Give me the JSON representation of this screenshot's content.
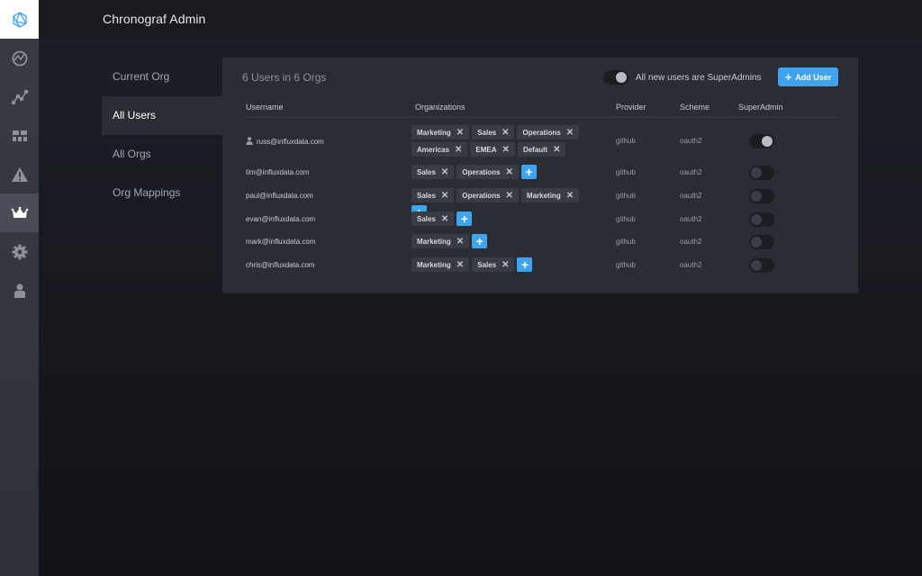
{
  "header": {
    "title": "Chronograf Admin"
  },
  "sidebar": {
    "icons": [
      "logo-icon",
      "status-icon",
      "data-explorer-icon",
      "dashboards-icon",
      "alerts-icon",
      "admin-crown-icon",
      "config-gear-icon",
      "user-icon"
    ]
  },
  "subnav": {
    "items": [
      {
        "label": "Current Org"
      },
      {
        "label": "All Users"
      },
      {
        "label": "All Orgs"
      },
      {
        "label": "Org Mappings"
      }
    ]
  },
  "panel": {
    "title": "6 Users in 6 Orgs",
    "superadmin_toggle_label": "All new users are SuperAdmins",
    "superadmin_toggle_on": true,
    "add_user_label": "Add User"
  },
  "table": {
    "headers": {
      "username": "Username",
      "organizations": "Organizations",
      "provider": "Provider",
      "scheme": "Scheme",
      "superadmin": "SuperAdmin"
    },
    "rows": [
      {
        "username": "russ@influxdata.com",
        "orgs": [
          "Marketing",
          "Sales",
          "Operations",
          "Americas",
          "EMEA",
          "Default"
        ],
        "provider": "github",
        "scheme": "oauth2",
        "superadmin": true,
        "current": true,
        "plus": false
      },
      {
        "username": "tim@influxdata.com",
        "orgs": [
          "Sales",
          "Operations"
        ],
        "provider": "github",
        "scheme": "oauth2",
        "superadmin": false,
        "current": false,
        "plus": true
      },
      {
        "username": "paul@influxdata.com",
        "orgs": [
          "Sales",
          "Operations",
          "Marketing"
        ],
        "provider": "github",
        "scheme": "oauth2",
        "superadmin": false,
        "current": false,
        "plus": true
      },
      {
        "username": "evan@influxdata.com",
        "orgs": [
          "Sales"
        ],
        "provider": "github",
        "scheme": "oauth2",
        "superadmin": false,
        "current": false,
        "plus": true
      },
      {
        "username": "mark@influxdata.com",
        "orgs": [
          "Marketing"
        ],
        "provider": "github",
        "scheme": "oauth2",
        "superadmin": false,
        "current": false,
        "plus": true
      },
      {
        "username": "chris@influxdata.com",
        "orgs": [
          "Marketing",
          "Sales"
        ],
        "provider": "github",
        "scheme": "oauth2",
        "superadmin": false,
        "current": false,
        "plus": true
      }
    ]
  },
  "colors": {
    "accent": "#3fa4ef",
    "panel": "#2b2d35",
    "sidebar": "#3a3c45"
  }
}
